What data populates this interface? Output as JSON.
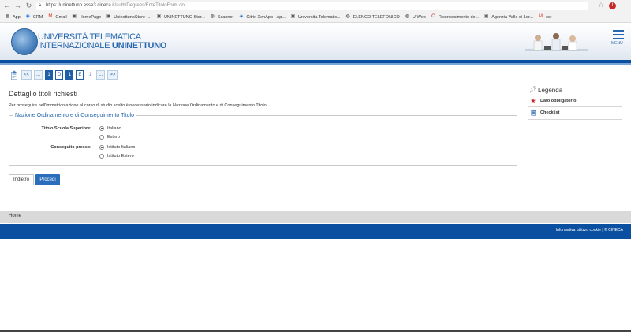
{
  "browser": {
    "url_host": "https://uninettuno.esse3.cineca.it",
    "url_path": "/auth/Degrees/EnteTitoloForm.do",
    "profile_initial": "I",
    "bookmarks": [
      {
        "label": "App",
        "icon": "apps-grid-icon",
        "color": "#5f6368"
      },
      {
        "label": "CRM",
        "icon": "crm-icon",
        "color": "#1a73e8"
      },
      {
        "label": "Gmail",
        "icon": "gmail-icon",
        "color": "#d93025"
      },
      {
        "label": "HomePage",
        "icon": "page-icon",
        "color": "#555555"
      },
      {
        "label": "UninettunoStore -...",
        "icon": "page-icon",
        "color": "#555555"
      },
      {
        "label": "UNINETTUNO Stor...",
        "icon": "page-icon",
        "color": "#555555"
      },
      {
        "label": "Scanner",
        "icon": "globe-icon",
        "color": "#333333"
      },
      {
        "label": "Citrix XenApp - Ap...",
        "icon": "citrix-icon",
        "color": "#1565c0"
      },
      {
        "label": "Università Telematic...",
        "icon": "page-icon",
        "color": "#555555"
      },
      {
        "label": "ELENCO TELEFONICO",
        "icon": "globe-icon",
        "color": "#333333"
      },
      {
        "label": "U-Web",
        "icon": "globe-icon",
        "color": "#333333"
      },
      {
        "label": "Riconoscimento de...",
        "icon": "c-icon",
        "color": "#c62828"
      },
      {
        "label": "Agenzia Valle di Lor...",
        "icon": "page-icon",
        "color": "#555555"
      },
      {
        "label": "esr",
        "icon": "gmail-icon",
        "color": "#d93025"
      }
    ]
  },
  "header": {
    "logo_line1": "UNIVERSITÀ TELEMATICA",
    "logo_line2a": "INTERNAZIONALE",
    "logo_line2b": "UNINETTUNO",
    "menu_label": "MENU"
  },
  "stepper": [
    {
      "label": "<<",
      "state": "normal"
    },
    {
      "label": "...",
      "state": "normal"
    },
    {
      "label": "1",
      "state": "active"
    },
    {
      "label": "D",
      "state": "current"
    },
    {
      "label": "1",
      "state": "active"
    },
    {
      "label": "E",
      "state": "current"
    },
    {
      "label": "1",
      "state": "plain"
    },
    {
      "label": "...",
      "state": "normal"
    },
    {
      "label": ">>",
      "state": "normal"
    }
  ],
  "main": {
    "title": "Dettaglio titoli richiesti",
    "intro": "Per proseguire nell'immatricolazione al corso di studio scelto è necessario indicare la Nazione Ordinamento e di Conseguimento Titolo.",
    "fieldset_legend": "Nazione Ordinamento e di Conseguimento Titolo",
    "q1_label": "Titolo Scuola Superiore:",
    "q1_opt1": "Italiano",
    "q1_opt2": "Estero",
    "q2_label": "Conseguito presso:",
    "q2_opt1": "Istituto Italiano",
    "q2_opt2": "Istituto Estero",
    "back_button": "Indietro",
    "next_button": "Procedi"
  },
  "sidebar": {
    "title": "Legenda",
    "item1": "Dato obbligatorio",
    "item2": "Checklist"
  },
  "footer": {
    "home": "Home",
    "right": "Informativa utilizzo cookie | © CINECA"
  }
}
